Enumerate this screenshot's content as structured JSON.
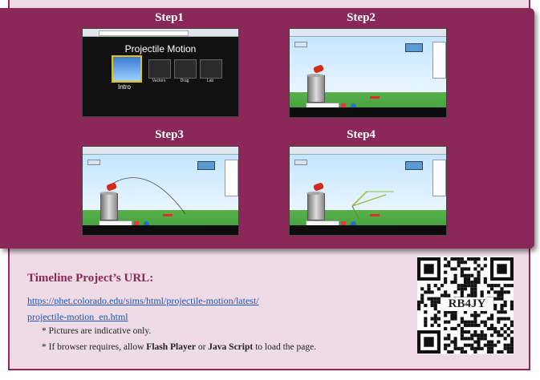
{
  "steps": [
    {
      "title": "Step1"
    },
    {
      "title": "Step2"
    },
    {
      "title": "Step3"
    },
    {
      "title": "Step4"
    }
  ],
  "intro_screen": {
    "title": "Projectile Motion",
    "tiles": [
      "Intro",
      "Vectors",
      "Drag",
      "Lab"
    ]
  },
  "url_section": {
    "heading": "Timeline Project’s URL:",
    "link_line1": "https://phet.colorado.edu/sims/html/projectile-motion/latest/",
    "link_line2": "projectile-motion_en.html"
  },
  "notes": {
    "note1": "* Pictures are indicative only.",
    "note2_prefix": "* If browser requires, allow ",
    "note2_flash": "Flash Player",
    "note2_or": " or ",
    "note2_js": "Java Script",
    "note2_suffix": " to load the page."
  },
  "qr": {
    "code": "RB4JY"
  },
  "colors": {
    "panel": "#8a2858",
    "frame": "#8c2a5c",
    "background": "#eedbe6",
    "link": "#1a56b3"
  }
}
